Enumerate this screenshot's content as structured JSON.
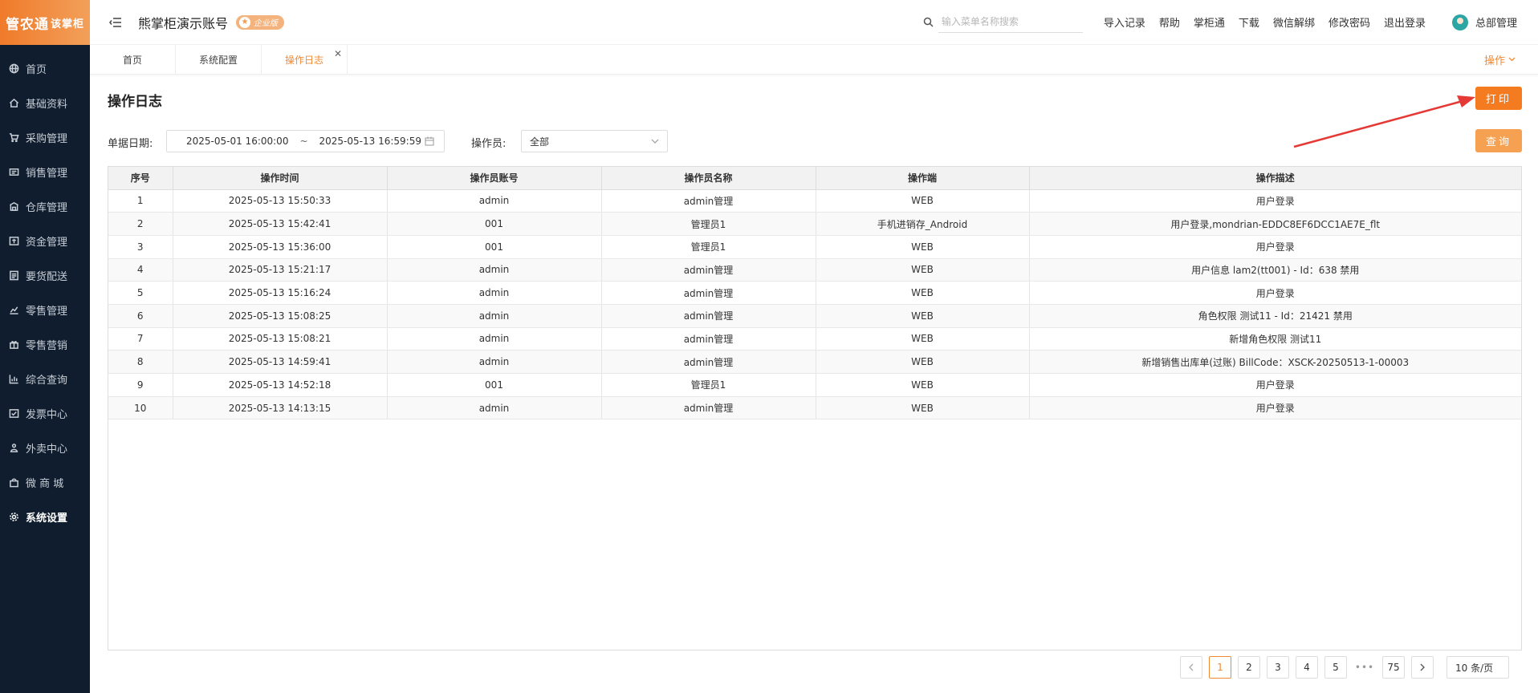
{
  "sidebar": {
    "logo_main": "管农通",
    "logo_sub": "该掌柜",
    "items": [
      {
        "label": "首页",
        "icon": "globe-icon"
      },
      {
        "label": "基础资料",
        "icon": "home-icon"
      },
      {
        "label": "采购管理",
        "icon": "cart-icon"
      },
      {
        "label": "销售管理",
        "icon": "sales-icon"
      },
      {
        "label": "仓库管理",
        "icon": "warehouse-icon"
      },
      {
        "label": "资金管理",
        "icon": "money-icon"
      },
      {
        "label": "要货配送",
        "icon": "list-icon"
      },
      {
        "label": "零售管理",
        "icon": "chart-icon"
      },
      {
        "label": "零售营销",
        "icon": "gift-icon"
      },
      {
        "label": "综合查询",
        "icon": "bar-chart-icon"
      },
      {
        "label": "发票中心",
        "icon": "invoice-icon"
      },
      {
        "label": "外卖中心",
        "icon": "delivery-icon"
      },
      {
        "label": "微 商 城",
        "icon": "shop-bag-icon"
      },
      {
        "label": "系统设置",
        "icon": "gear-icon"
      }
    ]
  },
  "header": {
    "account_title": "熊掌柜演示账号",
    "badge": "企业版",
    "search_placeholder": "输入菜单名称搜索",
    "links": [
      "导入记录",
      "帮助",
      "掌柜通",
      "下载",
      "微信解绑",
      "修改密码",
      "退出登录"
    ],
    "user_name": "总部管理"
  },
  "tabs": {
    "items": [
      "首页",
      "系统配置",
      "操作日志"
    ],
    "active_index": 2,
    "ops_label": "操作"
  },
  "page": {
    "title": "操作日志",
    "print_label": "打印",
    "query_label": "查询"
  },
  "filters": {
    "date_label": "单据日期:",
    "date_start": "2025-05-01 16:00:00",
    "date_sep": "~",
    "date_end": "2025-05-13 16:59:59",
    "operator_label": "操作员:",
    "operator_value": "全部"
  },
  "table": {
    "headers": [
      "序号",
      "操作时间",
      "操作员账号",
      "操作员名称",
      "操作端",
      "操作描述"
    ],
    "rows": [
      [
        "1",
        "2025-05-13 15:50:33",
        "admin",
        "admin管理",
        "WEB",
        "用户登录"
      ],
      [
        "2",
        "2025-05-13 15:42:41",
        "001",
        "管理员1",
        "手机进销存_Android",
        "用户登录,mondrian-EDDC8EF6DCC1AE7E_flt"
      ],
      [
        "3",
        "2025-05-13 15:36:00",
        "001",
        "管理员1",
        "WEB",
        "用户登录"
      ],
      [
        "4",
        "2025-05-13 15:21:17",
        "admin",
        "admin管理",
        "WEB",
        "用户信息 lam2(tt001) - Id：638 禁用"
      ],
      [
        "5",
        "2025-05-13 15:16:24",
        "admin",
        "admin管理",
        "WEB",
        "用户登录"
      ],
      [
        "6",
        "2025-05-13 15:08:25",
        "admin",
        "admin管理",
        "WEB",
        "角色权限 测试11 - Id：21421 禁用"
      ],
      [
        "7",
        "2025-05-13 15:08:21",
        "admin",
        "admin管理",
        "WEB",
        "新增角色权限 测试11"
      ],
      [
        "8",
        "2025-05-13 14:59:41",
        "admin",
        "admin管理",
        "WEB",
        "新增销售出库单(过账) BillCode：XSCK-20250513-1-00003"
      ],
      [
        "9",
        "2025-05-13 14:52:18",
        "001",
        "管理员1",
        "WEB",
        "用户登录"
      ],
      [
        "10",
        "2025-05-13 14:13:15",
        "admin",
        "admin管理",
        "WEB",
        "用户登录"
      ]
    ]
  },
  "pagination": {
    "pages": [
      "1",
      "2",
      "3",
      "4",
      "5"
    ],
    "ellipsis": "•••",
    "last_page": "75",
    "current": "1",
    "page_size": "10 条/页"
  },
  "colors": {
    "accent": "#f47b20",
    "sidebar_bg": "#0f1d2e",
    "annotation_arrow": "#e53935"
  }
}
